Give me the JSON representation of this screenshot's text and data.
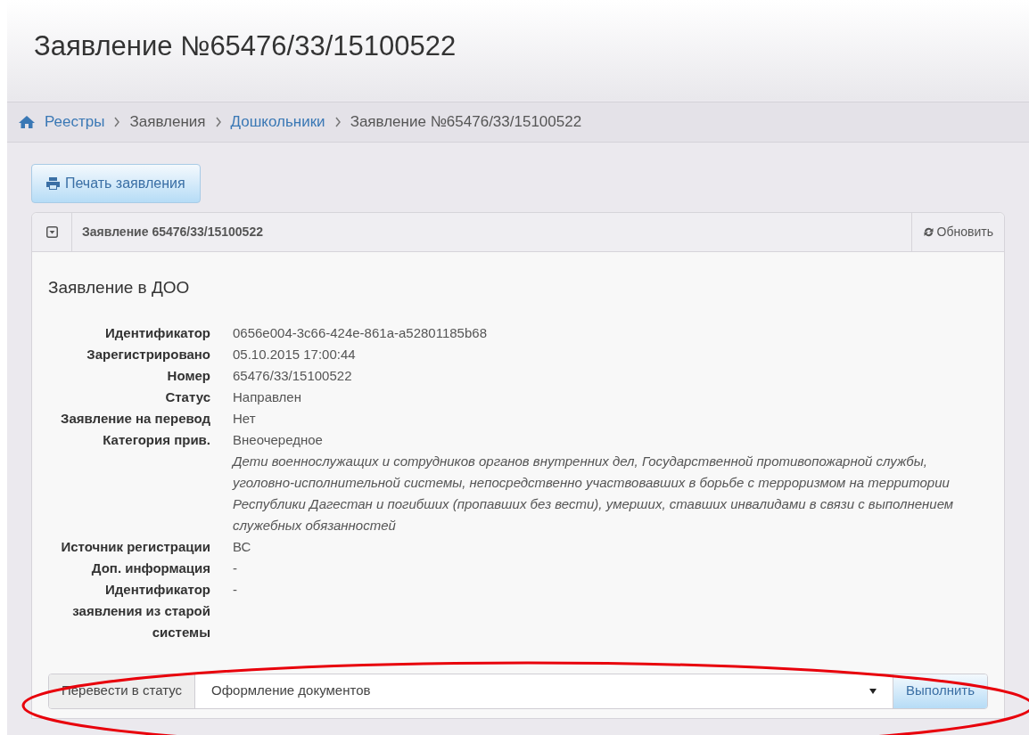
{
  "page_title": "Заявление №65476/33/15100522",
  "breadcrumb": [
    {
      "label": "Реестры",
      "kind": "link"
    },
    {
      "label": "Заявления",
      "kind": "text"
    },
    {
      "label": "Дошкольники",
      "kind": "link"
    },
    {
      "label": "Заявление №65476/33/15100522",
      "kind": "text"
    }
  ],
  "print_button": "Печать заявления",
  "panel": {
    "title": "Заявление 65476/33/15100522",
    "refresh": "Обновить",
    "heading": "Заявление в ДОО",
    "fields": [
      {
        "label": "Идентификатор",
        "value": "0656e004-3c66-424e-861a-a52801185b68"
      },
      {
        "label": "Зарегистрировано",
        "value": "05.10.2015 17:00:44"
      },
      {
        "label": "Номер",
        "value": "65476/33/15100522"
      },
      {
        "label": "Статус",
        "value": "Направлен"
      },
      {
        "label": "Заявление на перевод",
        "value": "Нет"
      },
      {
        "label": "Категория прив.",
        "value": "Внеочередное",
        "note": "Дети военнослужащих и сотрудников органов внутренних дел, Государственной противопожарной службы, уголовно-исполнительной системы, непосредственно участвовавших в борьбе с терроризмом на территории Республики Дагестан и погибших (пропавших без вести), умерших, ставших инвалидами в связи с выполнением служебных обязанностей"
      },
      {
        "label": "Источник регистрации",
        "value": "ВС"
      },
      {
        "label": "Доп. информация",
        "value": "-"
      },
      {
        "label": "Идентификатор заявления из старой системы",
        "value": "-"
      }
    ],
    "status_change": {
      "label": "Перевести в статус",
      "value": "Оформление документов",
      "button": "Выполнить"
    }
  }
}
